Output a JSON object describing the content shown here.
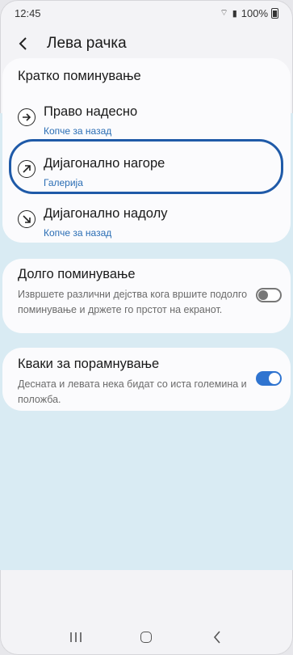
{
  "status_bar": {
    "time": "12:45",
    "battery": "100%"
  },
  "header": {
    "title": "Лева рачка"
  },
  "short_swipe": {
    "title": "Кратко поминување",
    "options": [
      {
        "icon": "arrow-right-icon",
        "label": "Право надесно",
        "action": "Копче за назад"
      },
      {
        "icon": "arrow-up-right-icon",
        "label": "Дијагонално нагоре",
        "action": "Галерија",
        "highlighted": true
      },
      {
        "icon": "arrow-down-right-icon",
        "label": "Дијагонално надолу",
        "action": "Копче за назад"
      }
    ]
  },
  "long_swipe": {
    "title": "Долго поминување",
    "description": "Извршете различни дејства кога вршите подолго поминување и држете го прстот на екранот.",
    "enabled": false
  },
  "handles_alignment": {
    "title": "Кваки за порамнување",
    "description": "Десната и левата нека бидат со иста големина и положба.",
    "enabled": true
  },
  "colors": {
    "accent": "#2f74d0",
    "highlight_ring": "#1f5aa8",
    "link": "#2a6db4"
  }
}
